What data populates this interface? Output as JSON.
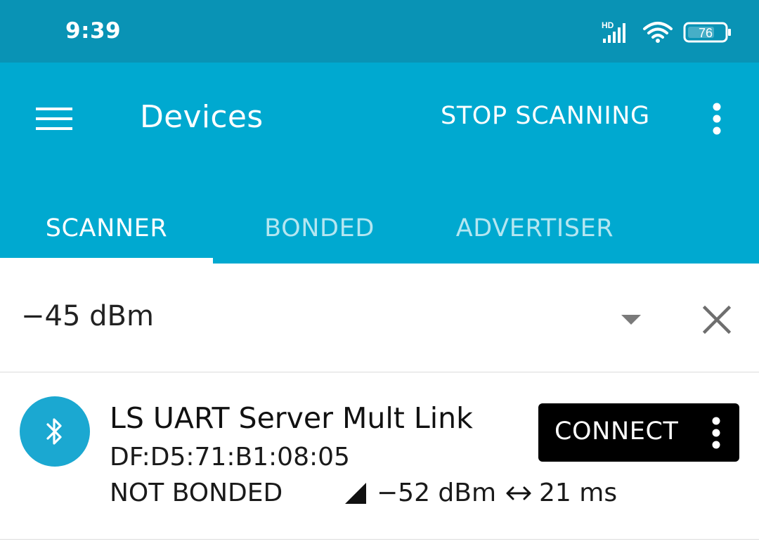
{
  "status_bar": {
    "time": "9:39",
    "network_label": "HD",
    "battery_level": "76",
    "icons": [
      "signal-icon",
      "wifi-icon",
      "battery-icon"
    ]
  },
  "app_bar": {
    "title": "Devices",
    "action_label": "STOP SCANNING",
    "menu_icon": "menu-icon",
    "overflow_icon": "more-vert-icon"
  },
  "tabs": [
    {
      "label": "SCANNER",
      "active": true
    },
    {
      "label": "BONDED",
      "active": false
    },
    {
      "label": "ADVERTISER",
      "active": false
    }
  ],
  "filter": {
    "value": "−45 dBm",
    "dropdown_icon": "dropdown-arrow-icon",
    "clear_icon": "close-icon"
  },
  "devices": [
    {
      "name": "LS UART Server Mult Link",
      "address": "DF:D5:71:B1:08:05",
      "bond_state": "NOT BONDED",
      "rssi": "−52 dBm",
      "interval": "21 ms",
      "icon": "bluetooth-icon",
      "connect_label": "CONNECT"
    }
  ],
  "colors": {
    "status_bar": "#0993b5",
    "app_bar": "#00a9d0",
    "inactive_tab": "#b4e6f1",
    "avatar": "#1ba8d1",
    "connect_button": "#000000"
  }
}
